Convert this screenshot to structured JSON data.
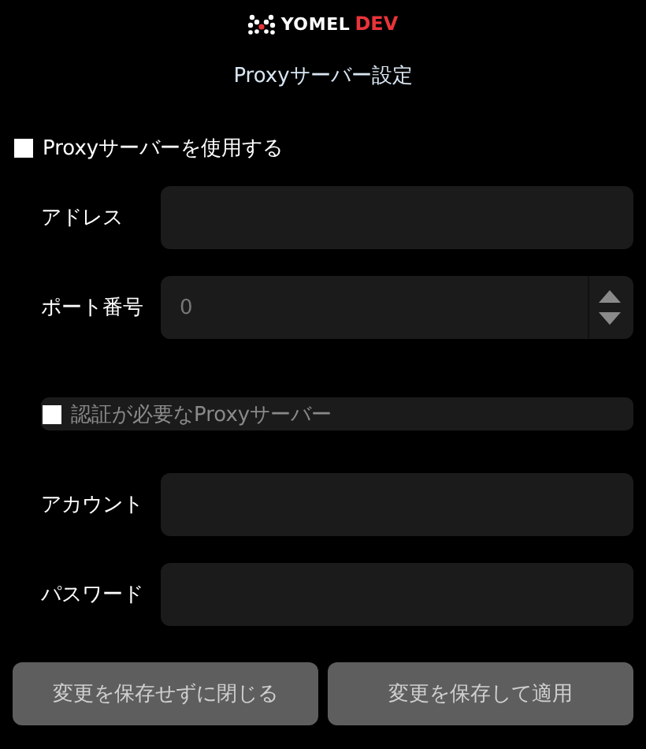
{
  "logo": {
    "brand": "YOMEL",
    "suffix": "DEV"
  },
  "title": "Proxyサーバー設定",
  "use_proxy": {
    "label": "Proxyサーバーを使用する",
    "checked": false
  },
  "proxy_fields": [
    {
      "label": "アドレス",
      "kind": "text"
    },
    {
      "label": "ポート番号",
      "kind": "number",
      "value": "0"
    }
  ],
  "auth": {
    "label": "認証が必要なProxyサーバー",
    "checked": false,
    "disabled": true
  },
  "auth_fields": [
    {
      "label": "アカウント",
      "kind": "text"
    },
    {
      "label": "パスワード",
      "kind": "text"
    }
  ],
  "buttons": [
    "変更を保存せずに閉じる",
    "変更を保存して適用"
  ]
}
